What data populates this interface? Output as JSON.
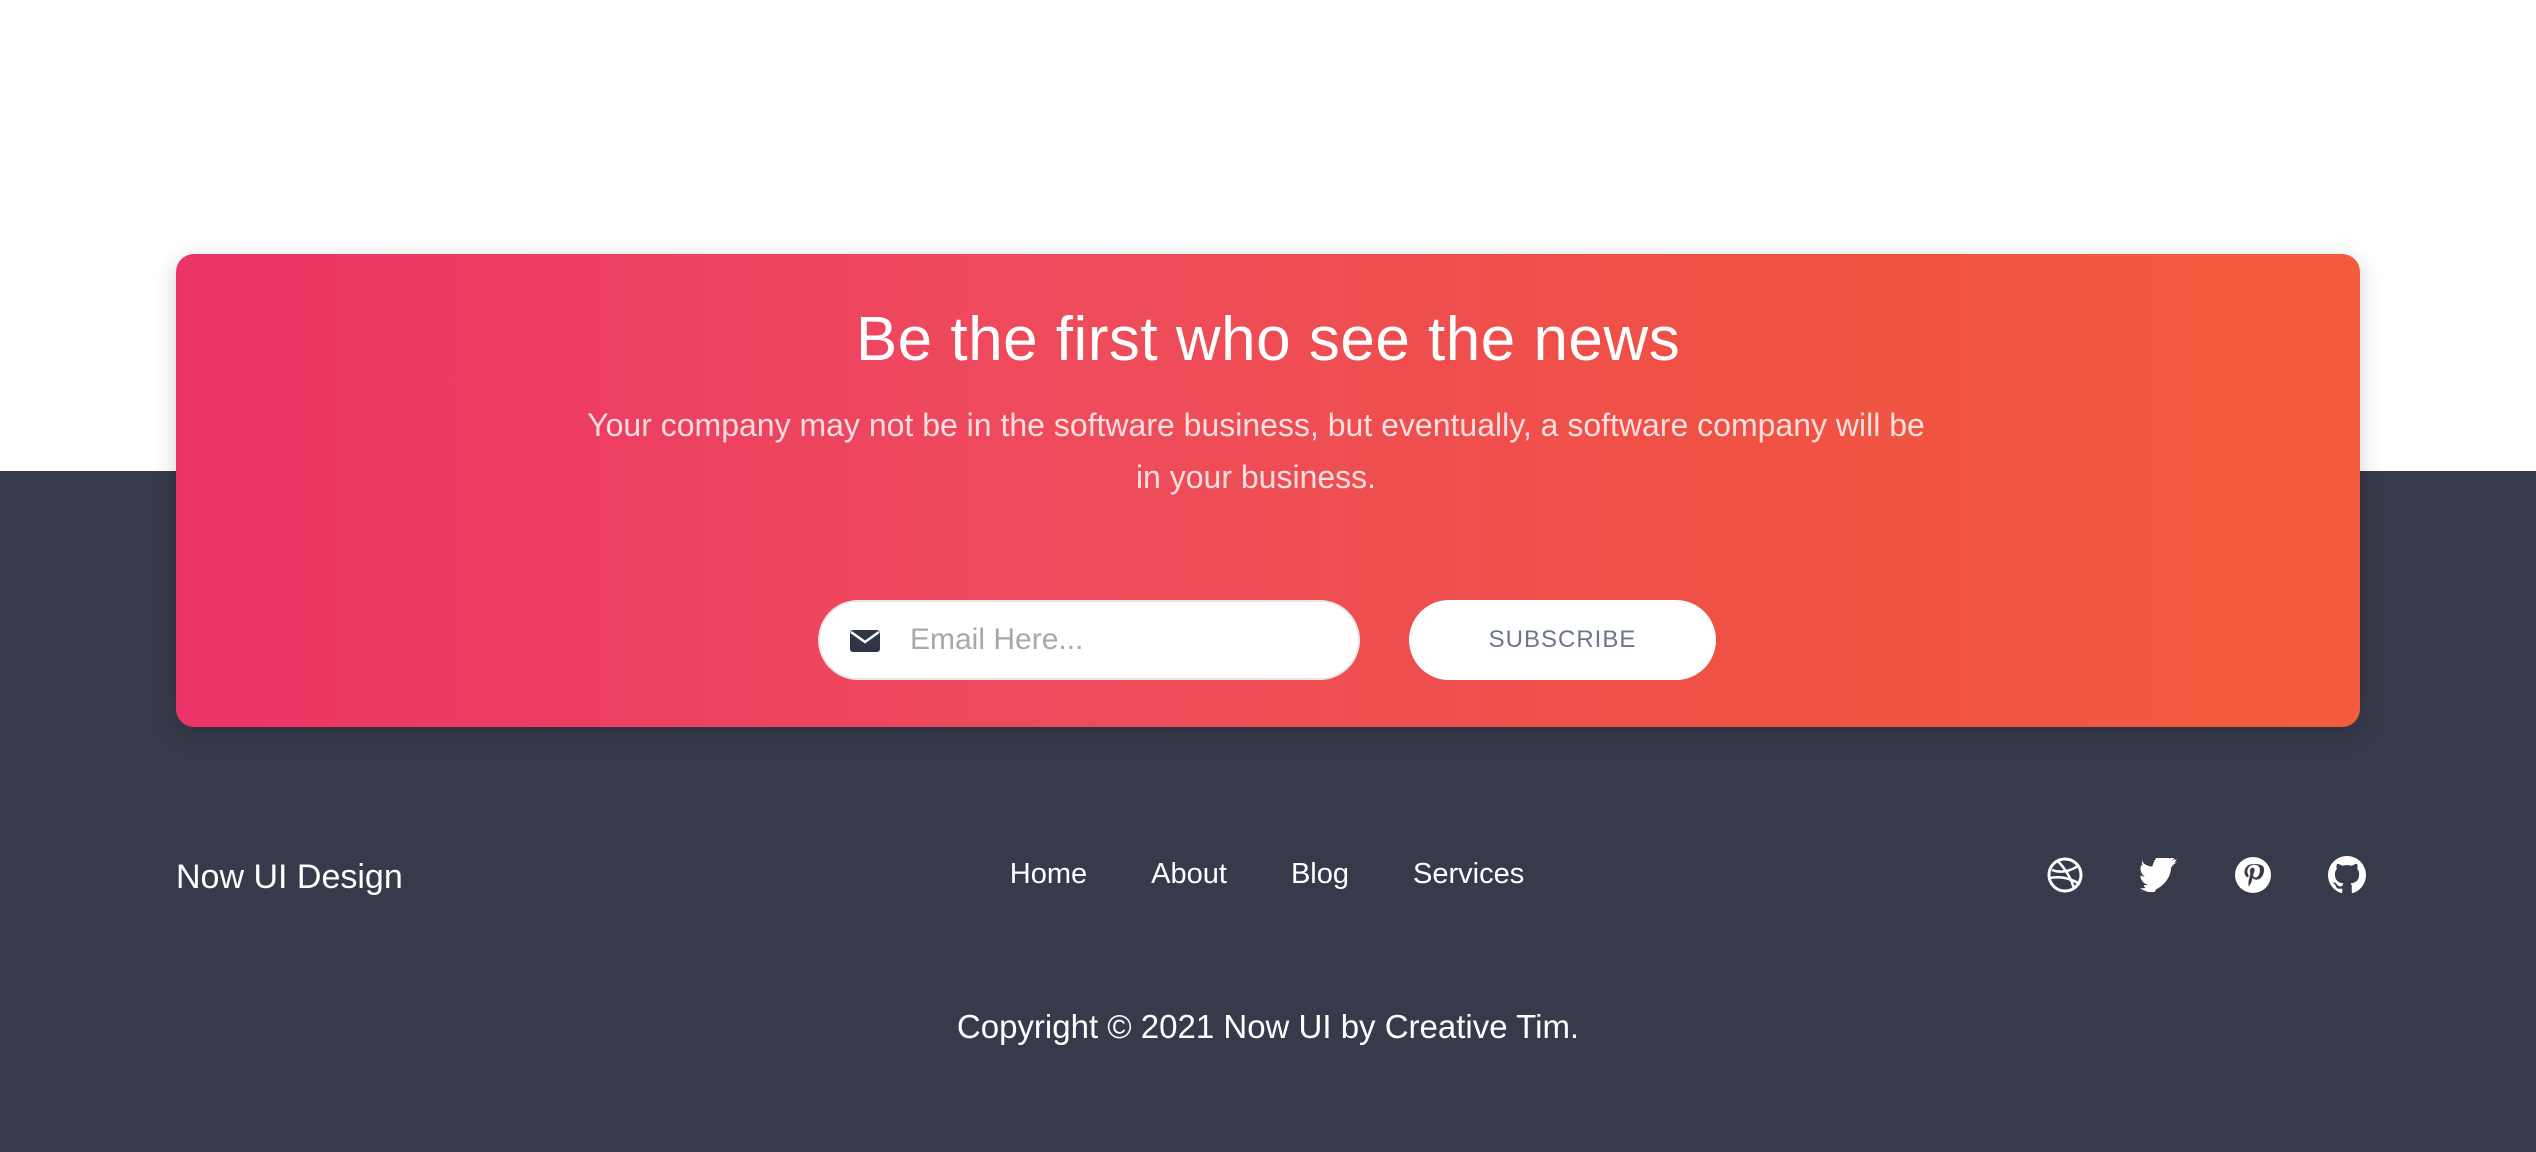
{
  "newsletter": {
    "title": "Be the first who see the news",
    "description": "Your company may not be in the software business, but eventually, a software company will be in your business.",
    "email_placeholder": "Email Here...",
    "email_value": "",
    "subscribe_label": "SUBSCRIBE",
    "email_icon": "envelope-icon"
  },
  "footer": {
    "brand": "Now UI Design",
    "nav": [
      {
        "label": "Home"
      },
      {
        "label": "About"
      },
      {
        "label": "Blog"
      },
      {
        "label": "Services"
      }
    ],
    "social": [
      {
        "icon": "dribbble-icon"
      },
      {
        "icon": "twitter-icon"
      },
      {
        "icon": "pinterest-icon"
      },
      {
        "icon": "github-icon"
      }
    ],
    "copyright": "Copyright © 2021 Now UI by Creative Tim."
  },
  "colors": {
    "gradient_start": "#ec3366",
    "gradient_end": "#f25c3c",
    "footer_bg": "#363a4a",
    "button_text": "#6d7788"
  }
}
